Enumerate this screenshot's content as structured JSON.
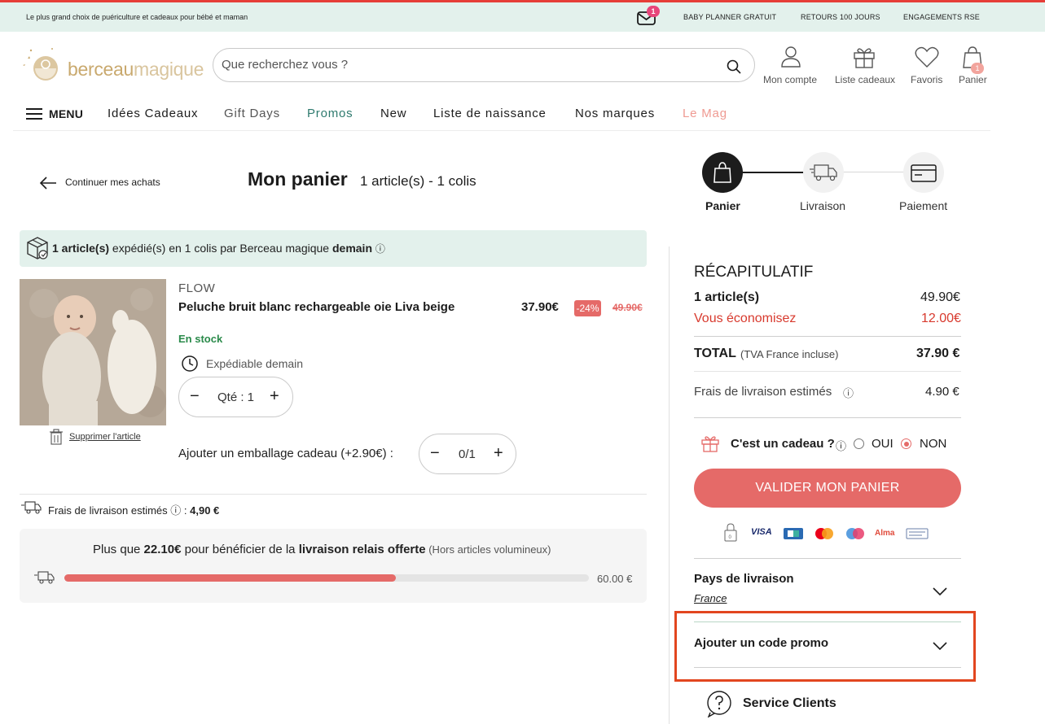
{
  "topbar": {
    "tagline": "Le plus grand choix de puériculture et cadeaux pour bébé et maman",
    "mail_badge": "1",
    "links": [
      "BABY PLANNER GRATUIT",
      "RETOURS 100 JOURS",
      "ENGAGEMENTS RSE"
    ]
  },
  "header": {
    "logo_part1": "berceau",
    "logo_part2": "magique",
    "search_placeholder": "Que recherchez vous ?",
    "account_label": "Mon compte",
    "giftlist_label": "Liste cadeaux",
    "favorites_label": "Favoris",
    "cart_label": "Panier",
    "cart_badge": "1"
  },
  "nav": {
    "menu": "MENU",
    "items": [
      "Idées Cadeaux",
      "Gift Days",
      "Promos",
      "New",
      "Liste de naissance",
      "Nos marques",
      "Le Mag"
    ],
    "promo_color": "#2e7a6e",
    "mag_color": "#ef9a92"
  },
  "cart": {
    "back_label": "Continuer mes achats",
    "title": "Mon panier",
    "subtitle": "1 article(s) - 1 colis",
    "steps": [
      "Panier",
      "Livraison",
      "Paiement"
    ],
    "shipping_banner": {
      "count": "1 article(s)",
      "middle": " expédié(s) en 1 colis par Berceau magique ",
      "when": "demain",
      "info": "ⓘ"
    },
    "product": {
      "brand": "FLOW",
      "name": "Peluche bruit blanc rechargeable oie Liva beige",
      "price": "37.90€",
      "discount": "-24%",
      "old_price": "49.90€",
      "stock": "En stock",
      "ship_note": "Expédiable demain",
      "qty_label": "Qté : 1",
      "delete_label": "Supprimer l'article",
      "gift_wrap_label": "Ajouter un emballage cadeau (+2.90€) :",
      "gift_wrap_qty": "0/1"
    },
    "fees": {
      "label": "Frais de livraison estimés",
      "info": "ⓘ :",
      "value": "4,90 €"
    },
    "free_shipping": {
      "prefix": "Plus que ",
      "amount": "22.10€",
      "middle": " pour bénéficier de la ",
      "bold": "livraison relais offerte",
      "note": " (Hors articles volumineux)",
      "progress_fraction": 0.632,
      "max_label": "60.00 €"
    }
  },
  "summary": {
    "title": "RÉCAPITULATIF",
    "articles_label": "1 article(s)",
    "articles_value": "49.90€",
    "savings_label": "Vous économisez",
    "savings_value": "12.00€",
    "total_label": "TOTAL",
    "total_note": "(TVA France incluse)",
    "total_value": "37.90 €",
    "fees_label": "Frais de livraison estimés",
    "fees_info": "ⓘ",
    "fees_value": "4.90 €",
    "gift_question": "C'est un cadeau ?",
    "gift_info": "ⓘ",
    "gift_yes": "OUI",
    "gift_no": "NON",
    "validate_label": "VALIDER MON PANIER",
    "lock_label": "0",
    "payment_methods": [
      "VISA",
      "CB",
      "Mastercard",
      "Maestro",
      "Alma",
      "Virement"
    ],
    "visa_text": "VISA",
    "alma_text": "Alma",
    "country_label": "Pays de livraison",
    "country_value": "France",
    "promo_label": "Ajouter un code promo",
    "service_label": "Service Clients",
    "accent_color": "#e56a68",
    "savings_color": "#d83a2e"
  }
}
